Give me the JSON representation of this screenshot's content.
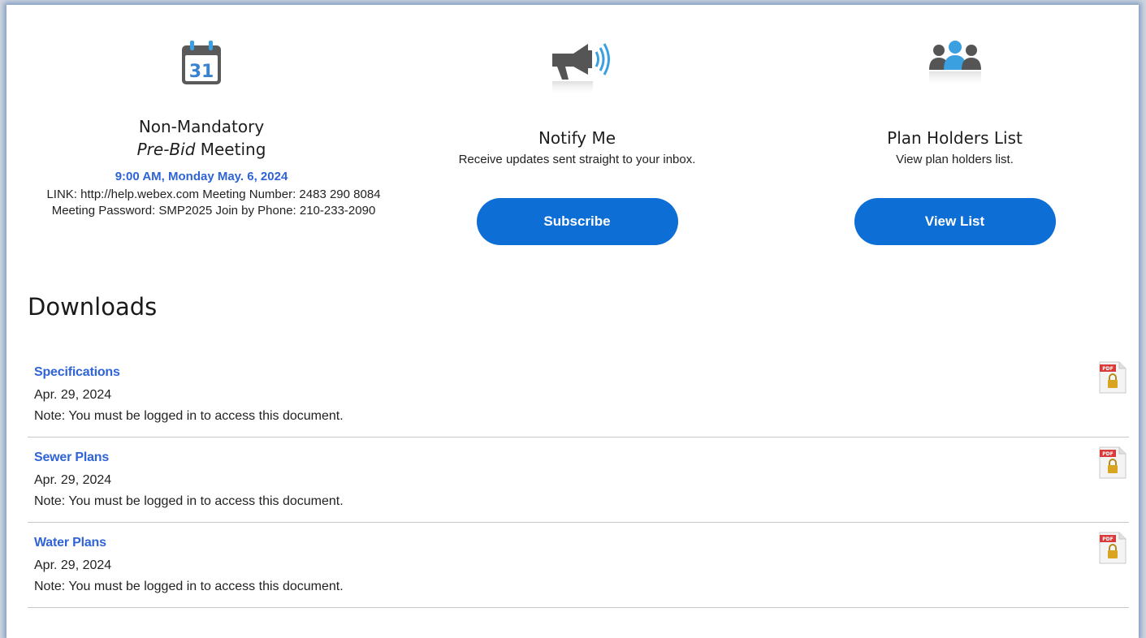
{
  "meeting": {
    "icon": "calendar-icon",
    "calendar_day": "31",
    "title_line1": "Non-Mandatory",
    "title_italic": "Pre-Bid",
    "title_rest": " Meeting",
    "datetime": "9:00 AM, Monday May. 6, 2024",
    "details": "LINK: http://help.webex.com Meeting Number: 2483 290 8084 Meeting Password: SMP2025 Join by Phone: 210-233-2090"
  },
  "notify": {
    "icon": "megaphone-icon",
    "title": "Notify Me",
    "subtitle": "Receive updates sent straight to your inbox.",
    "button_label": "Subscribe"
  },
  "plan_holders": {
    "icon": "people-group-icon",
    "title": "Plan Holders List",
    "subtitle": "View plan holders list.",
    "button_label": "View List"
  },
  "downloads": {
    "heading": "Downloads",
    "pdf_badge": "PDF",
    "items": [
      {
        "name": "Specifications",
        "date": "Apr. 29, 2024",
        "note": "Note: You must be logged in to access this document."
      },
      {
        "name": "Sewer Plans",
        "date": "Apr. 29, 2024",
        "note": "Note: You must be logged in to access this document."
      },
      {
        "name": "Water Plans",
        "date": "Apr. 29, 2024",
        "note": "Note: You must be logged in to access this document."
      }
    ]
  },
  "colors": {
    "accent_blue": "#0d6ed6",
    "link_blue": "#2f63d6",
    "icon_gray": "#5a5a5a",
    "icon_blue": "#3aa0e0",
    "pdf_red": "#d93a3a",
    "lock_gold": "#d9a520"
  }
}
